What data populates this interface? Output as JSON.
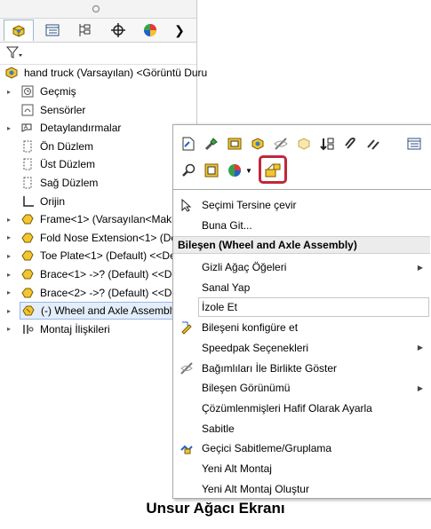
{
  "tree": {
    "root": "hand truck (Varsayılan) <Görüntü Duru",
    "items": [
      {
        "label": "Geçmiş",
        "icon": "history-icon",
        "expandable": true
      },
      {
        "label": "Sensörler",
        "icon": "sensor-icon",
        "expandable": false
      },
      {
        "label": "Detaylandırmalar",
        "icon": "annotation-icon",
        "expandable": true
      },
      {
        "label": "Ön Düzlem",
        "icon": "plane-icon",
        "expandable": false
      },
      {
        "label": "Üst Düzlem",
        "icon": "plane-icon",
        "expandable": false
      },
      {
        "label": "Sağ Düzlem",
        "icon": "plane-icon",
        "expandable": false
      },
      {
        "label": "Orijin",
        "icon": "origin-icon",
        "expandable": false
      },
      {
        "label": "Frame<1> (Varsayılan<Makin",
        "icon": "part-icon",
        "expandable": true
      },
      {
        "label": "Fold Nose Extension<1> (Defa",
        "icon": "part-icon",
        "expandable": true
      },
      {
        "label": "Toe Plate<1> (Default) <<Defa",
        "icon": "part-icon",
        "expandable": true
      },
      {
        "label": "Brace<1> ->? (Default) <<Def",
        "icon": "part-icon",
        "expandable": true
      },
      {
        "label": "Brace<2> ->? (Default) <<Def",
        "icon": "part-icon",
        "expandable": true
      },
      {
        "label": "(-) Wheel and Axle Assembly<",
        "icon": "subassembly-icon",
        "expandable": true,
        "selected": true
      },
      {
        "label": "Montaj İlişkileri",
        "icon": "mates-icon",
        "expandable": true
      }
    ]
  },
  "menu": {
    "invert": "Seçimi Tersine çevir",
    "find": "Buna Git...",
    "header": "Bileşen (Wheel and Axle Assembly)",
    "items": [
      {
        "label": "Gizli Ağaç Öğeleri",
        "submenu": true
      },
      {
        "label": "Sanal Yap"
      },
      {
        "label": "İzole Et",
        "highlight": true
      },
      {
        "label": "Bileşeni konfigüre et"
      },
      {
        "label": "Speedpak Seçenekleri",
        "submenu": true
      },
      {
        "label": "Bağımlıları İle Birlikte Göster"
      },
      {
        "label": "Bileşen Görünümü",
        "submenu": true
      },
      {
        "label": "Çözümlenmişleri Hafif Olarak Ayarla"
      },
      {
        "label": "Sabitle"
      },
      {
        "label": "Geçici Sabitleme/Gruplama"
      },
      {
        "label": "Yeni Alt Montaj"
      },
      {
        "label": "Yeni Alt Montaj Oluştur"
      }
    ]
  },
  "caption": "Unsur Ağacı Ekranı",
  "colors": {
    "highlight_box": "#c0283a",
    "selection": "#e4eefb"
  }
}
